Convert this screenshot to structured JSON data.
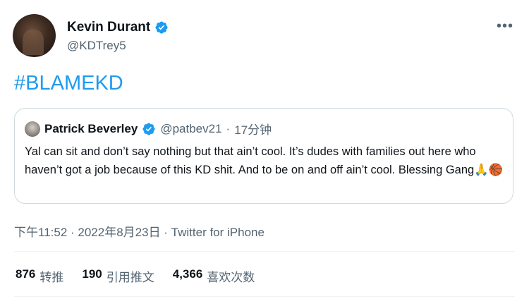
{
  "tweet": {
    "author": {
      "name": "Kevin Durant",
      "handle": "@KDTrey5"
    },
    "hashtag": "#BLAMEKD",
    "quoted": {
      "name": "Patrick Beverley",
      "handle": "@patbev21",
      "separator": "·",
      "time": "17分钟",
      "text": "Yal can sit and don’t say nothing but that ain’t cool. It’s dudes with families out here who haven’t got a job because of this KD shit. And to be on and off ain’t cool. Blessing Gang",
      "emojis": "🙏🏀"
    },
    "timestamp": "下午11:52 · 2022年8月23日 · Twitter for iPhone",
    "stats": {
      "retweets": {
        "count": "876",
        "label": "转推"
      },
      "quotes": {
        "count": "190",
        "label": "引用推文"
      },
      "likes": {
        "count": "4,366",
        "label": "喜欢次数"
      }
    }
  },
  "icons": {
    "verified": "verified-badge-icon",
    "more": "more-options-icon"
  },
  "colors": {
    "accent": "#1d9bf0",
    "secondary_text": "#536471",
    "border": "#cfd9de"
  }
}
